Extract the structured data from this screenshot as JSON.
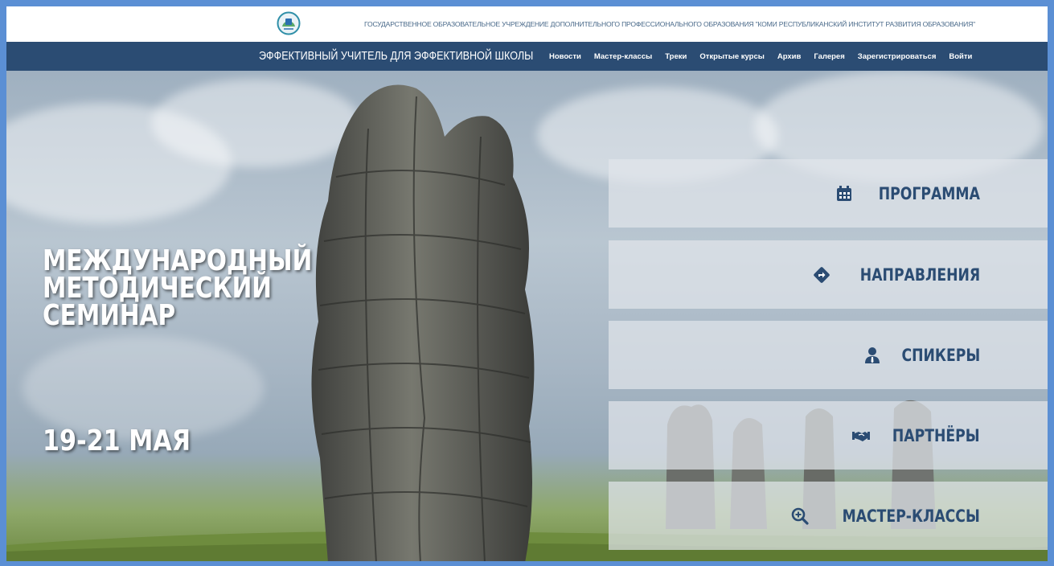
{
  "header": {
    "institute_name": "ГОСУДАРСТВЕННОЕ ОБРАЗОВАТЕЛЬНОЕ УЧРЕЖДЕНИЕ ДОПОЛНИТЕЛЬНОГО ПРОФЕССИОНАЛЬНОГО ОБРАЗОВАНИЯ \"КОМИ РЕСПУБЛИКАНСКИЙ ИНСТИТУТ РАЗВИТИЯ ОБРАЗОВАНИЯ\"",
    "logo_icon": "institute-logo-icon"
  },
  "nav": {
    "site_title": "ЭФФЕКТИВНЫЙ УЧИТЕЛЬ ДЛЯ ЭФФЕКТИВНОЙ ШКОЛЫ",
    "items": [
      {
        "label": "Новости"
      },
      {
        "label": "Мастер-классы"
      },
      {
        "label": "Треки"
      },
      {
        "label": "Открытые курсы"
      },
      {
        "label": "Архив"
      },
      {
        "label": "Галерея"
      },
      {
        "label": "Зарегистрироваться"
      },
      {
        "label": "Войти"
      }
    ]
  },
  "hero": {
    "title_lines": [
      "МЕЖДУНАРОДНЫЙ",
      "МЕТОДИЧЕСКИЙ",
      "СЕМИНАР"
    ],
    "dates": "19-21 МАЯ"
  },
  "panel": {
    "buttons": [
      {
        "label": "ПРОГРАММА",
        "icon": "calendar-icon"
      },
      {
        "label": "НАПРАВЛЕНИЯ",
        "icon": "direction-sign-icon"
      },
      {
        "label": "СПИКЕРЫ",
        "icon": "speaker-person-icon"
      },
      {
        "label": "ПАРТНЁРЫ",
        "icon": "handshake-icon"
      },
      {
        "label": "МАСТЕР-КЛАССЫ",
        "icon": "zoom-in-icon"
      }
    ]
  },
  "colors": {
    "nav_bg": "#2b4c73",
    "accent": "#2b4c73",
    "page_border": "#5b8fd4"
  }
}
